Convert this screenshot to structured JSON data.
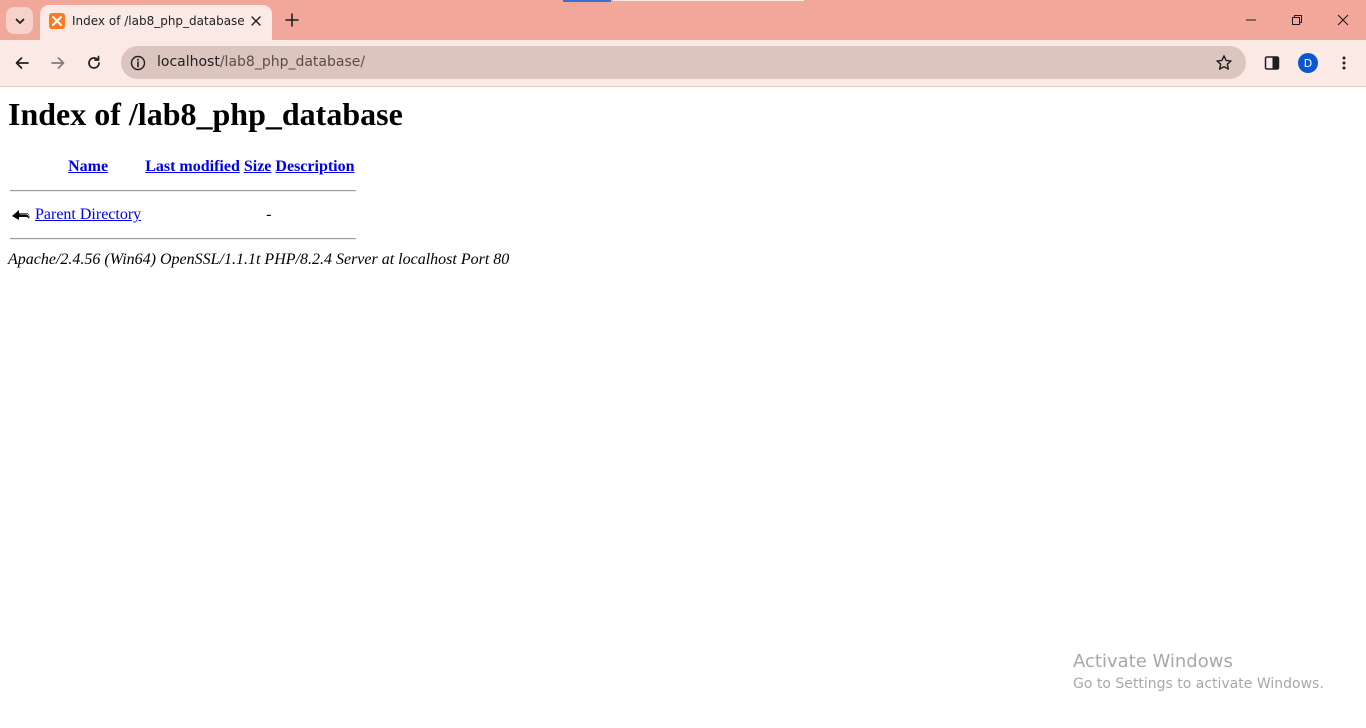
{
  "browser": {
    "tab": {
      "title": "Index of /lab8_php_database"
    },
    "omnibox": {
      "host": "localhost",
      "path": "/lab8_php_database/"
    },
    "profile_initial": "D",
    "colors": {
      "frame": "#f1a799",
      "toolbar": "#fbe9e5",
      "omnibox": "#dcc5bf",
      "favicon": "#fb7a24",
      "avatar": "#0b57d0"
    }
  },
  "page": {
    "heading": "Index of /lab8_php_database",
    "columns": {
      "name": "Name",
      "last_modified": "Last modified",
      "size": "Size",
      "description": "Description"
    },
    "rows": [
      {
        "name": "Parent Directory",
        "last_modified": "",
        "size": "-",
        "description": "",
        "icon": "back-icon"
      }
    ],
    "address": "Apache/2.4.56 (Win64) OpenSSL/1.1.1t PHP/8.2.4 Server at localhost Port 80"
  },
  "watermark": {
    "title": "Activate Windows",
    "subtitle": "Go to Settings to activate Windows."
  }
}
